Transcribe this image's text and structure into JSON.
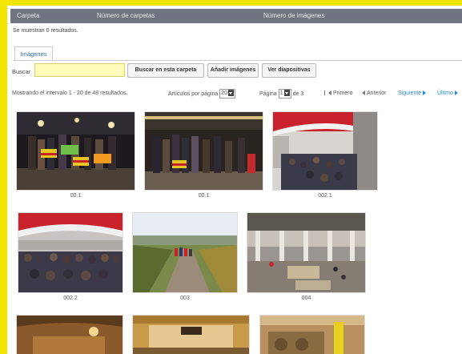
{
  "table_header": {
    "col1": "Carpeta",
    "col2": "Número de carpetas",
    "col3": "Número de imágenes"
  },
  "results_message": "Se muestran 0 resultados.",
  "tabs": [
    {
      "label": "Imágenes"
    }
  ],
  "search": {
    "label": "Buscar",
    "value": ""
  },
  "buttons": {
    "search_folder": "Buscar en esta carpeta",
    "add_images": "Añadir imágenes",
    "slideshow": "Ver diapositivas"
  },
  "pager": {
    "range_text": "Mostrando el intervalo 1 - 20 de 48 resultados.",
    "per_page_label": "Artículos por página",
    "per_page_value": "20",
    "page_label": "Página",
    "page_value": "1",
    "page_of": "de 3",
    "first": "Primero",
    "prev": "Anterior",
    "next": "Siguiente",
    "last": "Último"
  },
  "thumbnails": [
    {
      "caption": "00.1"
    },
    {
      "caption": "00.1"
    },
    {
      "caption": "002.1"
    },
    {
      "caption": "002.2"
    },
    {
      "caption": "003"
    },
    {
      "caption": "004"
    },
    {
      "caption": ""
    },
    {
      "caption": ""
    },
    {
      "caption": ""
    }
  ]
}
